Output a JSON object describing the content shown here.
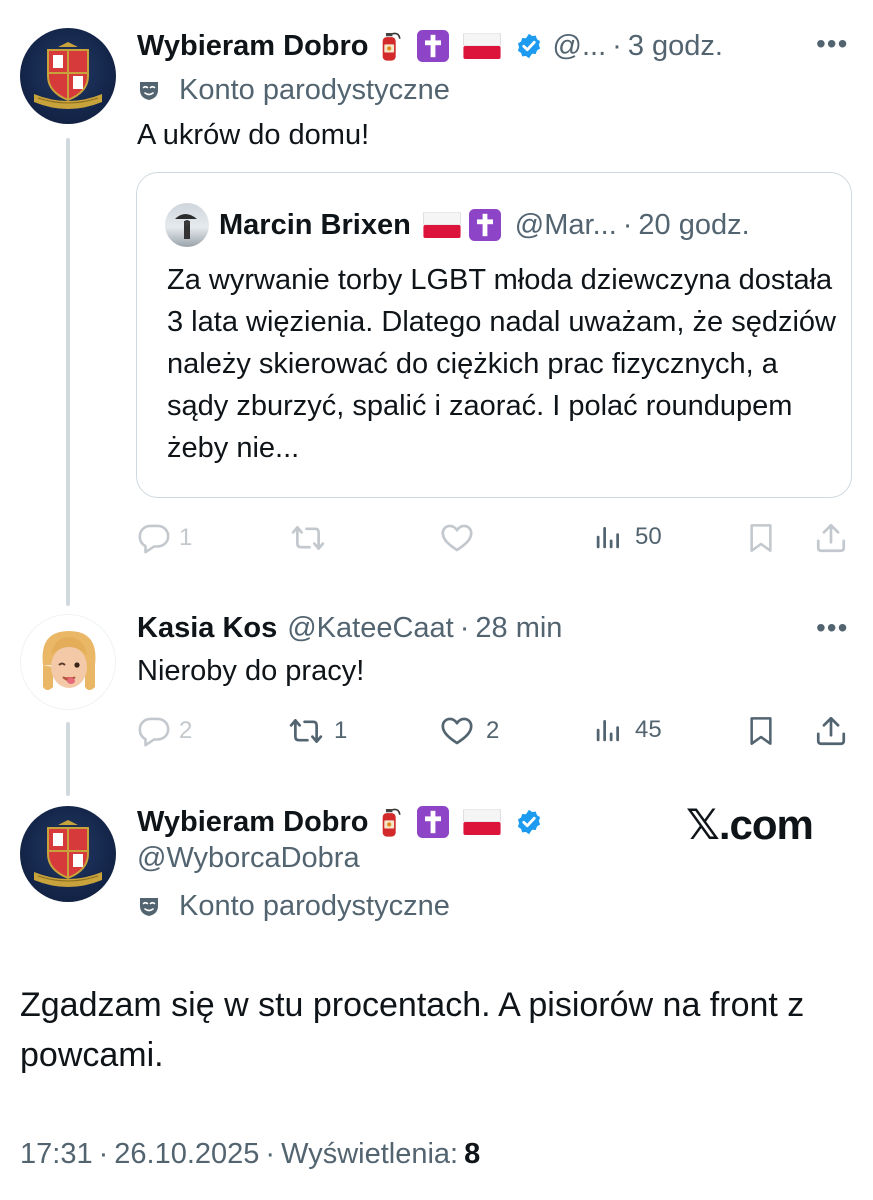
{
  "tweet1": {
    "name": "Wybieram Dobro",
    "handle": "@...",
    "sep": "·",
    "time": "3 godz.",
    "parody_label": "Konto parodystyczne",
    "text": "A ukrów do domu!",
    "quote": {
      "name": "Marcin Brixen",
      "handle": "@Mar...",
      "sep": "·",
      "time": "20 godz.",
      "text": "Za wyrwanie torby LGBT młoda dziewczyna dostała 3 lata więzienia. Dlatego nadal uważam, że sędziów należy skierować do ciężkich prac fizycznych, a sądy zburzyć, spalić i zaorać. I polać roundupem żeby nie..."
    },
    "stats": {
      "replies": "1",
      "views": "50"
    }
  },
  "tweet2": {
    "name": "Kasia Kos",
    "handle": "@KateeCaat",
    "sep": "·",
    "time": "28 min",
    "text": "Nieroby do pracy!",
    "stats": {
      "replies": "2",
      "retweets": "1",
      "likes": "2",
      "views": "45"
    }
  },
  "main": {
    "name": "Wybieram Dobro",
    "handle": "@WyborcaDobra",
    "parody_label": "Konto parodystyczne",
    "watermark": "𝕏.com",
    "text": "Zgadzam się w stu procentach. A pisiorów na front z powcami.",
    "footer": {
      "time": "17:31",
      "date": "26.10.2025",
      "sep": "·",
      "views_label": "Wyświetlenia:",
      "views_count": "8"
    }
  },
  "icons": {
    "more": "more-dots-icon",
    "verified": "verified-badge-icon",
    "parody": "parody-mask-icon",
    "extinguisher": "fire-extinguisher-emoji",
    "cross": "latin-cross-emoji",
    "flag": "poland-flag-emoji",
    "reply": "reply-icon",
    "retweet": "retweet-icon",
    "like": "heart-icon",
    "views": "views-chart-icon",
    "bookmark": "bookmark-icon",
    "share": "share-icon"
  },
  "colors": {
    "text": "#0f1419",
    "secondary": "#536471",
    "verified": "#1d9bf0",
    "border": "#cfd9de",
    "thread_line": "#cfd9de"
  }
}
